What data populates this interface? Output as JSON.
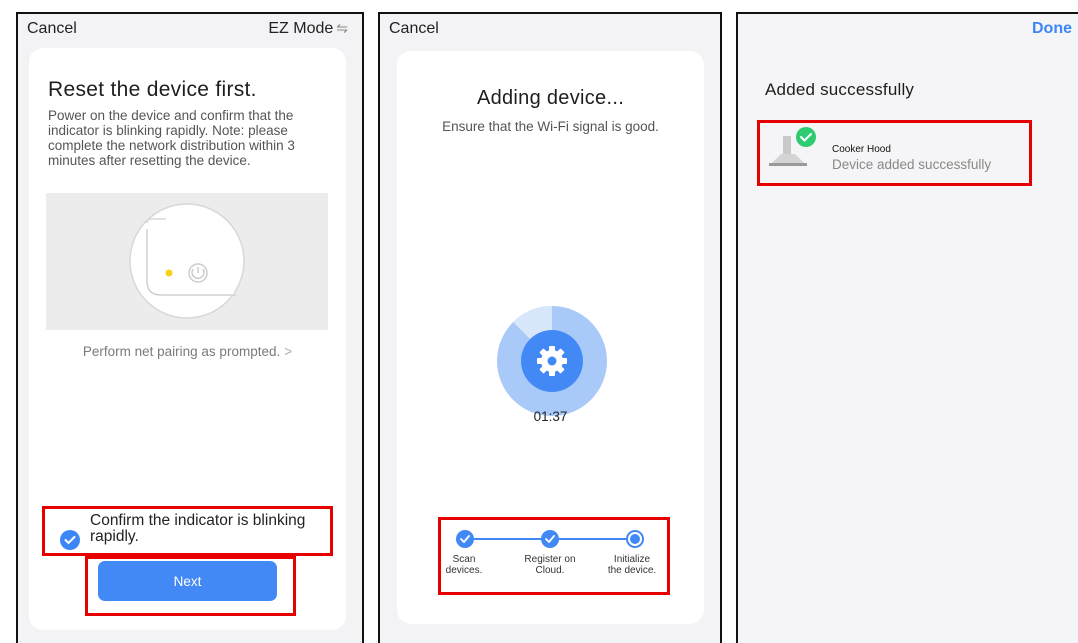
{
  "screen1": {
    "cancel": "Cancel",
    "mode": "EZ Mode",
    "mode_icon": "switch-arrows-icon",
    "title": "Reset the device first.",
    "description": "Power on the device and confirm that the indicator is blinking rapidly. Note: please complete the network distribution within 3 minutes after resetting the device.",
    "perform_link": "Perform net pairing as prompted.",
    "perform_chevron": ">",
    "confirm_text": "Confirm the indicator is blinking rapidly.",
    "confirm_checked": true,
    "next": "Next"
  },
  "screen2": {
    "cancel": "Cancel",
    "title": "Adding device...",
    "description": "Ensure that the Wi-Fi signal is good.",
    "timer": "01:37",
    "steps": [
      {
        "label": "Scan devices.",
        "state": "done"
      },
      {
        "label": "Register on Cloud.",
        "state": "done"
      },
      {
        "label": "Initialize the device.",
        "state": "active"
      }
    ]
  },
  "screen3": {
    "done": "Done",
    "title": "Added successfully",
    "device_name": "Cooker Hood",
    "device_status": "Device added successfully"
  },
  "colors": {
    "accent": "#4289f6",
    "highlight_box": "#e60000",
    "success": "#2ecc71"
  }
}
